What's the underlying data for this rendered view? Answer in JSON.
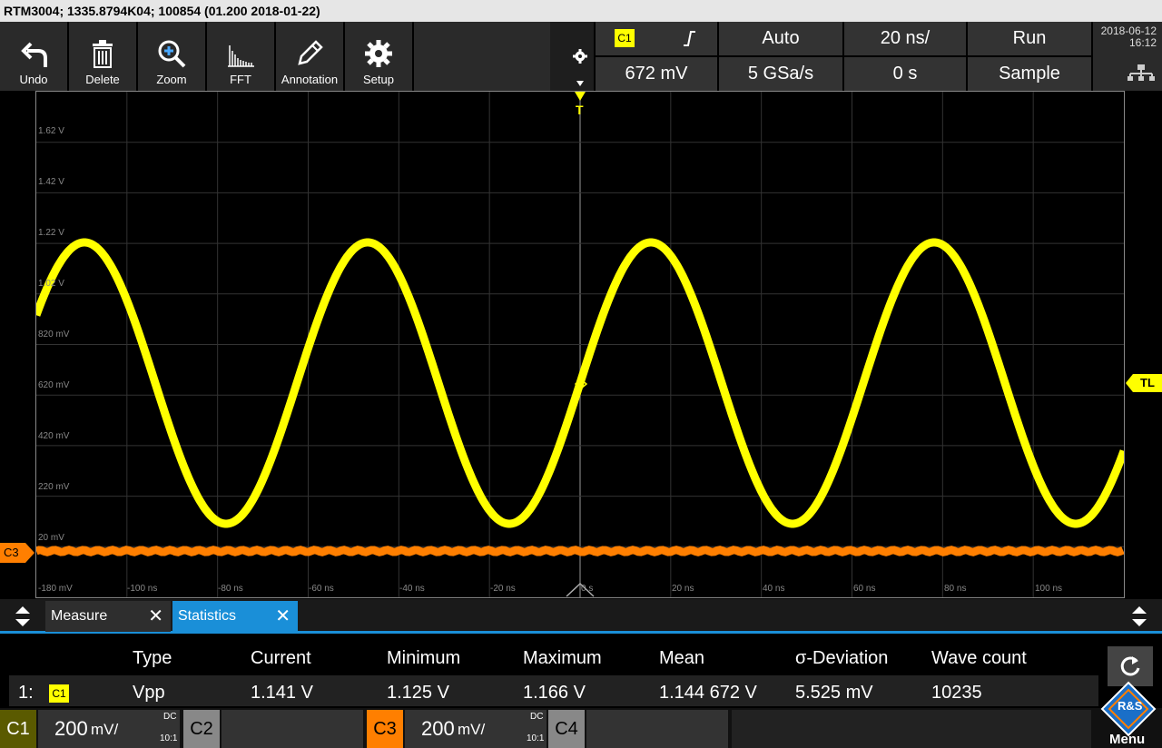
{
  "title": "RTM3004; 1335.8794K04; 100854 (01.200 2018-01-22)",
  "toolbar": [
    {
      "label": "Undo",
      "icon": "undo-icon"
    },
    {
      "label": "Delete",
      "icon": "trash-icon"
    },
    {
      "label": "Zoom",
      "icon": "zoom-icon"
    },
    {
      "label": "FFT",
      "icon": "fft-icon"
    },
    {
      "label": "Annotation",
      "icon": "pencil-icon"
    },
    {
      "label": "Setup",
      "icon": "gear-icon"
    }
  ],
  "settings": {
    "source": "C1",
    "trigger_mode": "Auto",
    "timebase": "20 ns/",
    "run_state": "Run",
    "trigger_level": "672 mV",
    "sample_rate": "5 GSa/s",
    "offset": "0 s",
    "acq_mode": "Sample",
    "date": "2018-06-12",
    "time": "16:12"
  },
  "grid": {
    "v_labels": [
      "1.62 V",
      "1.42 V",
      "1.22 V",
      "1.02 V",
      "820 mV",
      "620 mV",
      "420 mV",
      "220 mV",
      "20 mV",
      "-180 mV"
    ],
    "h_labels": [
      "-100 ns",
      "-80 ns",
      "-60 ns",
      "-40 ns",
      "-20 ns",
      "0 s",
      "20 ns",
      "40 ns",
      "60 ns",
      "80 ns",
      "100 ns"
    ],
    "trigger_marker": "T",
    "trigger_level_marker": "TL",
    "ch3_marker": "C3"
  },
  "tabs": [
    {
      "label": "Measure",
      "active": false
    },
    {
      "label": "Statistics",
      "active": true
    }
  ],
  "stats": {
    "headers": [
      "Type",
      "Current",
      "Minimum",
      "Maximum",
      "Mean",
      "σ-Deviation",
      "Wave count"
    ],
    "row": {
      "index": "1:",
      "source": "C1",
      "values": [
        "Vpp",
        "1.141 V",
        "1.125 V",
        "1.166 V",
        "1.144 672 V",
        "5.525 mV",
        "10235"
      ]
    }
  },
  "channels": [
    {
      "name": "C1",
      "scale_num": "200",
      "scale_unit": "mV/",
      "coupling": "DC",
      "ratio": "10:1",
      "color": "#e0e000"
    },
    {
      "name": "C2",
      "color": "#888888"
    },
    {
      "name": "C3",
      "scale_num": "200",
      "scale_unit": "mV/",
      "coupling": "DC",
      "ratio": "10:1",
      "color": "#ff7f00"
    },
    {
      "name": "C4",
      "color": "#888888"
    }
  ],
  "menu_label": "Menu",
  "logo_text": "R&S",
  "colors": {
    "ch1": "#ffff00",
    "ch3": "#ff7f00",
    "accent": "#1a8fd8"
  }
}
